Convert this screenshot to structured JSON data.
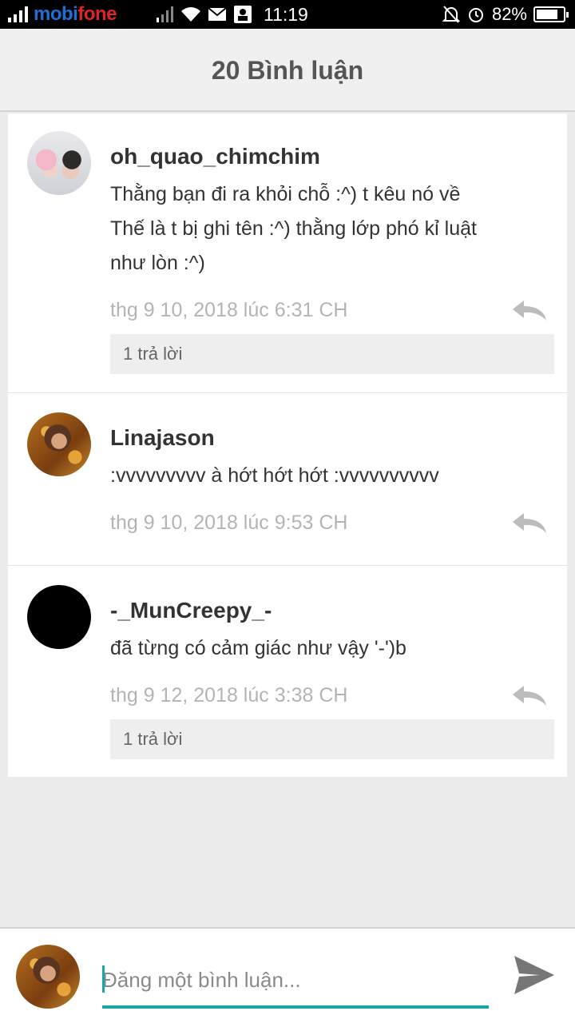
{
  "status_bar": {
    "carrier_part1": "mobi",
    "carrier_part2": "fone",
    "time": "11:19",
    "battery": "82%",
    "battery_level": 0.82
  },
  "header": {
    "title": "20 Bình luận"
  },
  "comments": [
    {
      "username": "oh_quao_chimchim",
      "lines": [
        "Thằng bạn đi ra khỏi chỗ :^) t kêu nó về",
        "Thế là t bị ghi tên :^) thằng lớp phó kỉ luật",
        "như lòn :^)"
      ],
      "time": "thg 9 10, 2018 lúc 6:31 CH",
      "replies": "1 trả lời"
    },
    {
      "username": "Linajason",
      "lines": [
        ":vvvvvvvvv à hớt hớt hớt :vvvvvvvvvv"
      ],
      "time": "thg 9 10, 2018 lúc 9:53 CH"
    },
    {
      "username": "-_MunCreepy_-",
      "lines": [
        "đã từng có cảm giác như vậy '-')b"
      ],
      "time": "thg 9 12, 2018 lúc 3:38 CH",
      "replies": "1 trả lời"
    }
  ],
  "composer": {
    "placeholder": "Đăng một bình luận..."
  },
  "colors": {
    "accent": "#1aa7a1",
    "carrier_mobi": "#1e6fd6",
    "carrier_fone": "#e02424"
  }
}
